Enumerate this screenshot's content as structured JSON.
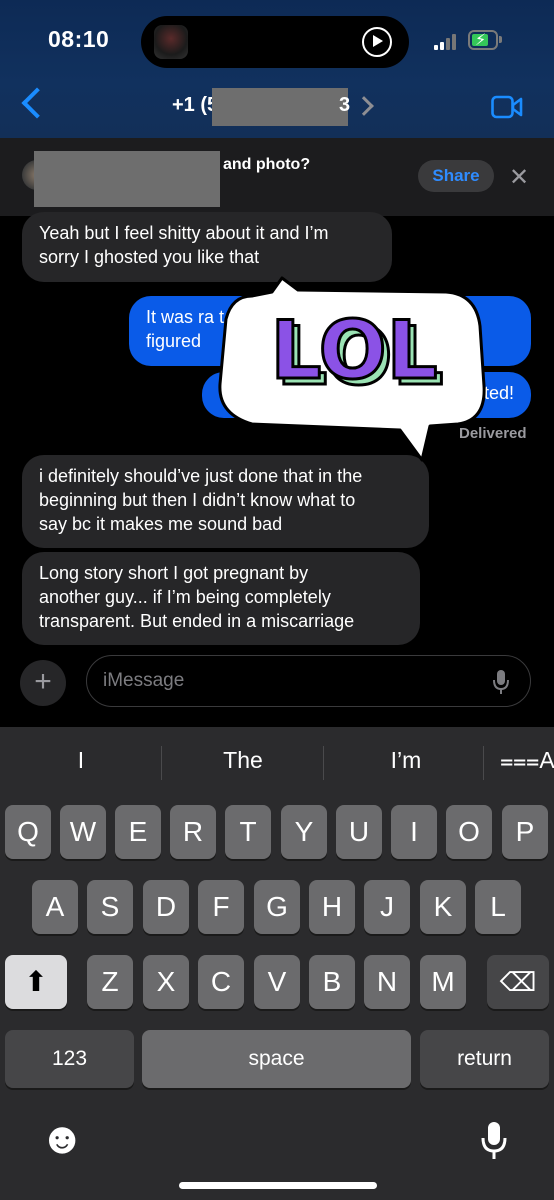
{
  "status_bar": {
    "time": "08:10"
  },
  "header": {
    "contact_prefix": "+1 (5",
    "contact_suffix": "3"
  },
  "share_banner": {
    "text": "and photo?",
    "share_label": "Share",
    "close_glyph": "✕"
  },
  "messages": [
    {
      "side": "incoming",
      "text": "Yeah but I feel shitty about it and I’m\nsorry I ghosted you like that"
    },
    {
      "side": "outgoing",
      "text": "It was ra                                    t but\nfigured"
    },
    {
      "side": "outgoing",
      "text": "ated!"
    },
    {
      "side": "incoming",
      "text": "i definitely should’ve just done that in the\nbeginning but then I didn’t know what to\nsay bc it makes me sound bad"
    },
    {
      "side": "incoming",
      "text": "Long story short I got pregnant by\nanother guy... if I’m being completely\ntransparent. But ended in a miscarriage"
    }
  ],
  "delivered_label": "Delivered",
  "sticker": {
    "text": "LOL",
    "fill_color": "#8b52e6",
    "side_color": "#9be3b4"
  },
  "input": {
    "plus_glyph": "+",
    "placeholder": "iMessage"
  },
  "keyboard": {
    "suggestions": [
      "I",
      "The",
      "I’m"
    ],
    "format_glyph": "⩶A",
    "row1": [
      "Q",
      "W",
      "E",
      "R",
      "T",
      "Y",
      "U",
      "I",
      "O",
      "P"
    ],
    "row2": [
      "A",
      "S",
      "D",
      "F",
      "G",
      "H",
      "J",
      "K",
      "L"
    ],
    "row3": [
      "Z",
      "X",
      "C",
      "V",
      "B",
      "N",
      "M"
    ],
    "numbers_label": "123",
    "space_label": "space",
    "return_label": "return",
    "emoji_glyph": "☻",
    "shift_glyph": "⬆",
    "delete_glyph": "⌫"
  },
  "colors": {
    "accent": "#1a8cff",
    "outgoing_bubble": "#0a5be8",
    "incoming_bubble": "#262628"
  }
}
